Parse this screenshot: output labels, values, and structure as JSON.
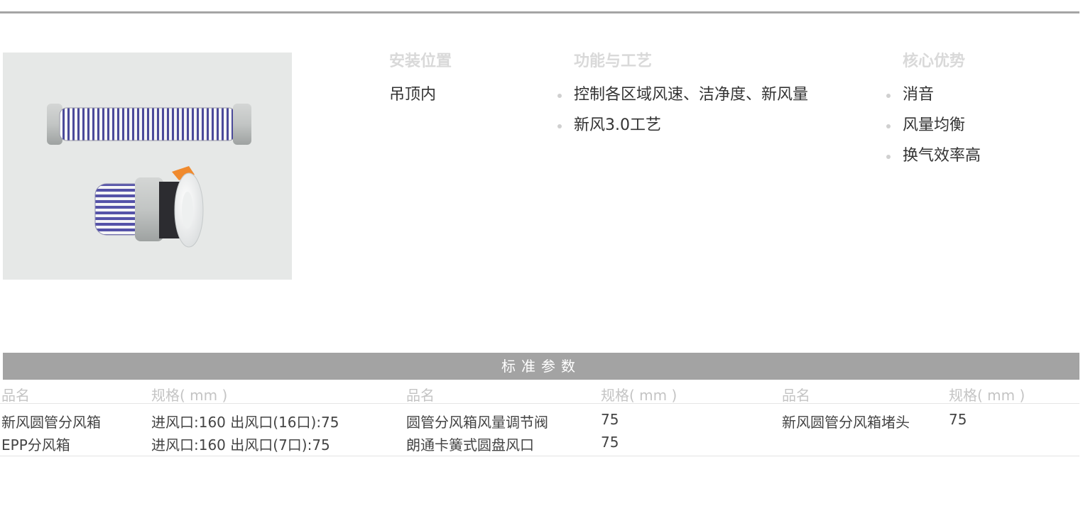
{
  "product": {
    "install_position": {
      "heading": "安装位置",
      "value": "吊顶内"
    },
    "function_process": {
      "heading": "功能与工艺",
      "items": [
        "控制各区域风速、洁净度、新风量",
        "新风3.0工艺"
      ]
    },
    "core_advantages": {
      "heading": "核心优势",
      "items": [
        "消音",
        "风量均衡",
        "换气效率高"
      ]
    }
  },
  "specs": {
    "banner_title": "标准参数",
    "headers": [
      "品名",
      "规格( mm )",
      "品名",
      "规格( mm )",
      "品名",
      "规格( mm )"
    ],
    "rows": [
      [
        "新风圆管分风箱",
        "进风口:160  出风口(16口):75",
        "圆管分风箱风量调节阀",
        "75",
        "新风圆管分风箱堵头",
        "75"
      ],
      [
        "EPP分风箱",
        "进风口:160  出风口(7口):75",
        "朗通卡簧式圆盘风口",
        "75",
        "",
        ""
      ]
    ]
  },
  "colors": {
    "banner_bg": "#a3a3a3",
    "heading_text": "#d9d9d9",
    "body_text": "#333333",
    "image_bg": "#e6e8e7",
    "stripe": "#4b4a9a"
  }
}
